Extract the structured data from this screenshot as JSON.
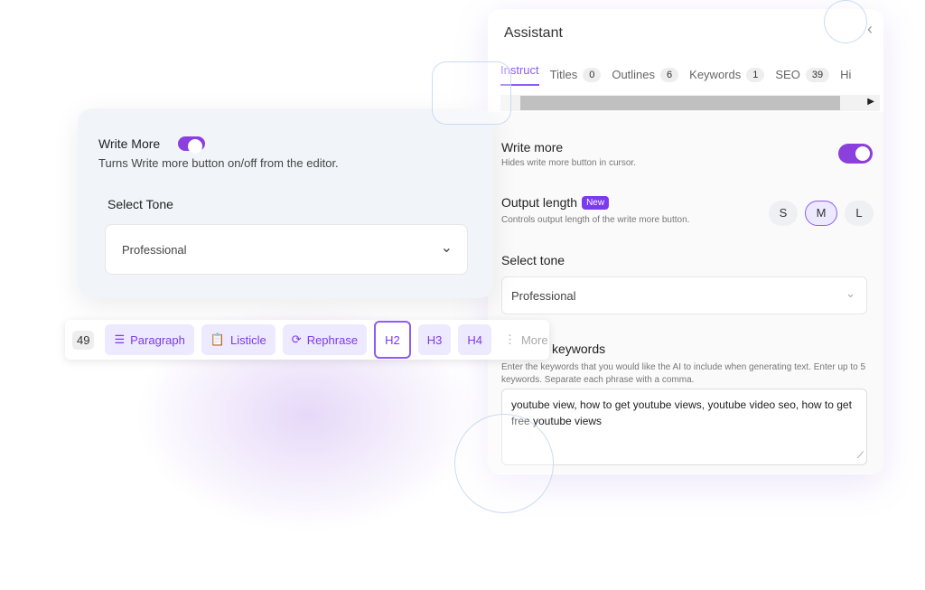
{
  "assistant": {
    "title": "Assistant",
    "tabs": [
      {
        "label": "Instruct"
      },
      {
        "label": "Titles",
        "count": "0"
      },
      {
        "label": "Outlines",
        "count": "6"
      },
      {
        "label": "Keywords",
        "count": "1"
      },
      {
        "label": "SEO",
        "count": "39"
      },
      {
        "label": "Hi"
      }
    ],
    "write_more": {
      "label": "Write more",
      "desc": "Hides write more button in cursor.",
      "enabled": true
    },
    "output_length": {
      "label": "Output length",
      "badge": "New",
      "desc": "Controls output length of the write more button.",
      "options": [
        "S",
        "M",
        "L"
      ],
      "selected": "M"
    },
    "select_tone": {
      "label": "Select tone",
      "value": "Professional"
    },
    "keywords": {
      "label": "keywords",
      "desc": "Enter the keywords that you would like the AI to include when generating text. Enter up to 5 keywords. Separate each phrase with a comma.",
      "value": "youtube view, how to get youtube views, youtube video seo, how to get free youtube views"
    }
  },
  "card": {
    "write_more_label": "Write More",
    "write_more_enabled": true,
    "write_more_desc": "Turns Write more button on/off from the editor.",
    "tone_label": "Select Tone",
    "tone_value": "Professional"
  },
  "toolbar": {
    "count": "49",
    "paragraph": "Paragraph",
    "listicle": "Listicle",
    "rephrase": "Rephrase",
    "h2": "H2",
    "h3": "H3",
    "h4": "H4",
    "more": "More"
  },
  "colors": {
    "accent": "#8b5cf6",
    "toggle": "#8b3fdc"
  }
}
